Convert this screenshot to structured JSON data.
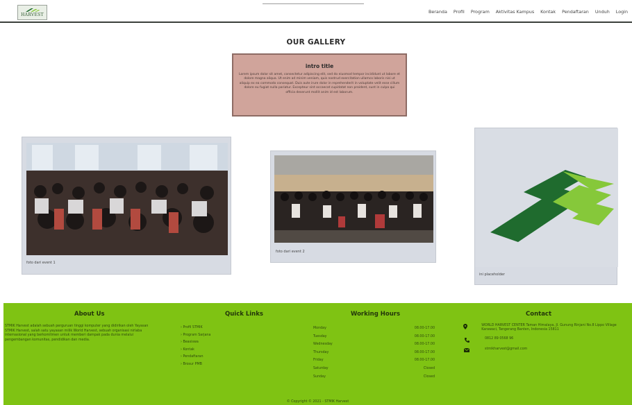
{
  "header": {
    "logo_text": "HARVEST",
    "nav": [
      "Beranda",
      "Profil",
      "Program",
      "Aktivitas Kampus",
      "Kontak",
      "Pendaftaran",
      "Unduh",
      "Login"
    ]
  },
  "gallery": {
    "title": "OUR GALLERY",
    "intro_title": "intro title",
    "intro_text": "Lorem ipsum dolor sit amet, consectetur adipiscing elit, sed do eiusmod tempor incididunt ut labore et dolore magna aliqua. Ut enim ad minim veniam, quis nostrud exercitation ullamco laboris nisi ut aliquip ex ea commodo consequat. Duis aute irure dolor in reprehenderit in voluptate velit esse cillum dolore eu fugiat nulla pariatur. Excepteur sint occaecat cupidatat non proident, sunt in culpa qui officia deserunt mollit anim id est laborum.",
    "cards": [
      {
        "caption": "foto dari event 1"
      },
      {
        "caption": "foto dari event 2"
      },
      {
        "caption": "ini placeholder"
      }
    ]
  },
  "footer": {
    "about_title": "About Us",
    "about_text": "STMIK Harvest adalah sebuah perguruan tinggi komputer yang didirikan oleh Yayasan STMIK Harvest, salah satu yayasan milik World Harvest, sebuah organisasi nirlaba internasional yang berkomitmen untuk memberi dampak pada dunia melalui pengembangan komunitas, pendidikan dan media.",
    "links_title": "Quick Links",
    "links": [
      "› Profil STMIK",
      "› Program Sarjana",
      "› Beasiswa",
      "› Kontak",
      "› Pendaftaran",
      "› Brosur PMB"
    ],
    "hours_title": "Working Hours",
    "hours": [
      {
        "day": "Monday",
        "time": "08.00-17.00"
      },
      {
        "day": "Tuesday",
        "time": "08.00-17.00"
      },
      {
        "day": "Wednesday",
        "time": "08.00-17.00"
      },
      {
        "day": "Thursday",
        "time": "08.00-17.00"
      },
      {
        "day": "Friday",
        "time": "08.00-17.00"
      },
      {
        "day": "Saturday",
        "time": "Closed"
      },
      {
        "day": "Sunday",
        "time": "Closed"
      }
    ],
    "contact_title": "Contact",
    "contact": [
      {
        "icon": "location-pin-icon",
        "text": "WORLD HARVEST CENTER Taman Himalaya, Jl. Gunung Rinjani No.8 Lippo Village Karawaci, Tangerang Banten, Indonesia 15811"
      },
      {
        "icon": "phone-icon",
        "text": "0812 89 0568 96"
      },
      {
        "icon": "envelope-icon",
        "text": "stmikharvest@gmail.com"
      }
    ],
    "copyright": "© Copyright © 2021 - STMIK Harvest"
  },
  "colors": {
    "footer_green": "#7fc313",
    "intro_box": "#d0a49b",
    "logo_dark_green": "#1f6b2e",
    "logo_light_green": "#86c83a"
  }
}
